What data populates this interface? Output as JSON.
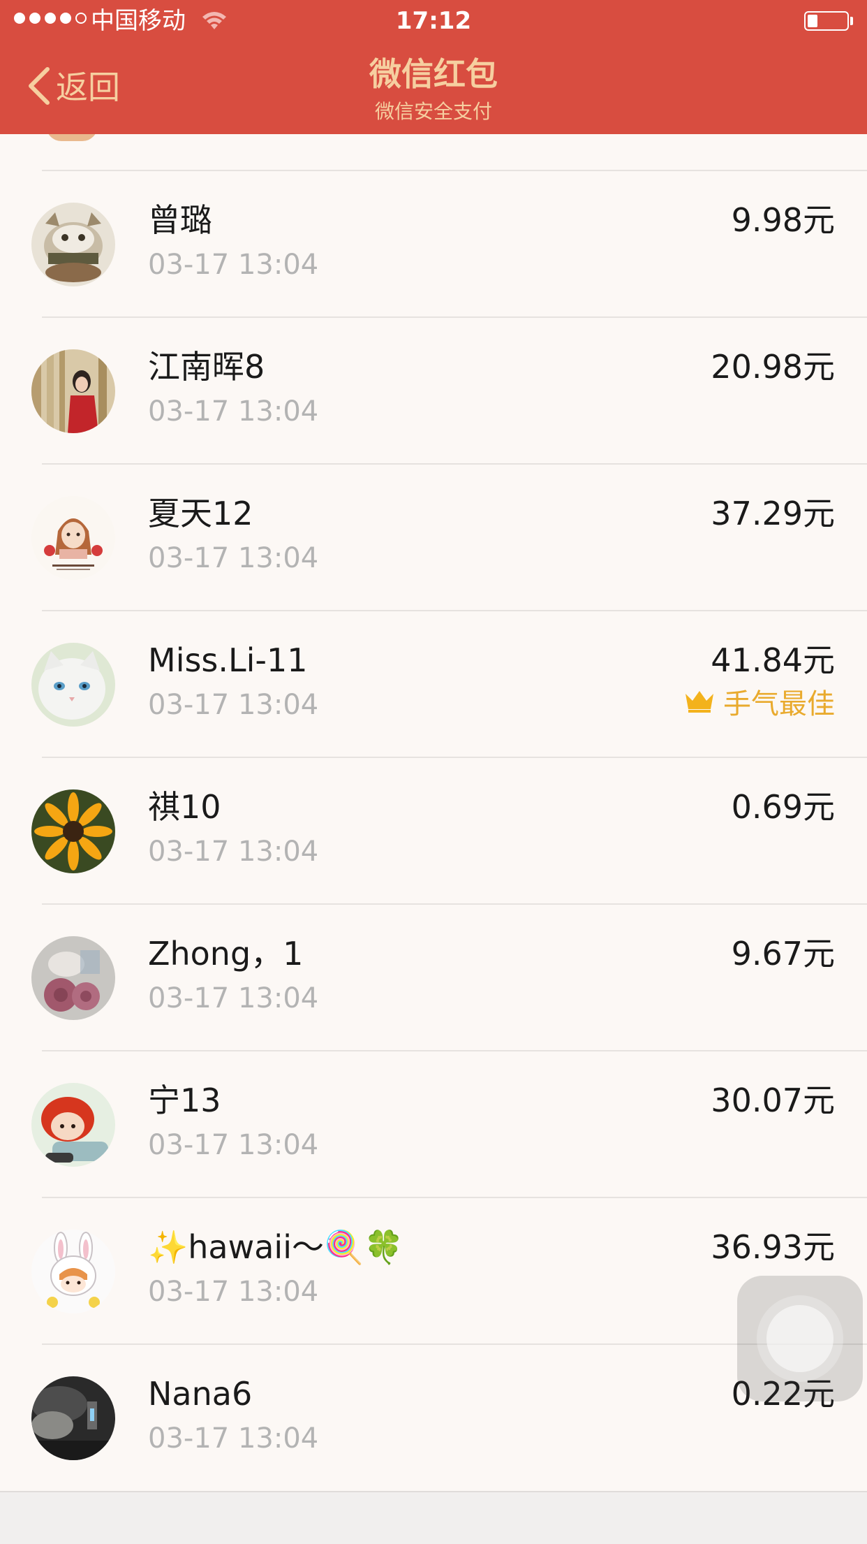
{
  "status_bar": {
    "carrier": "中国移动",
    "time": "17:12",
    "battery_level": 0.25
  },
  "nav": {
    "back_label": "返回",
    "title": "微信红包",
    "subtitle": "微信安全支付"
  },
  "records": [
    {
      "name": "曾璐",
      "time": "03-17 13:04",
      "amount": "9.98元",
      "avatar": "cat-photo-avatar"
    },
    {
      "name": "江南晖8",
      "time": "03-17 13:04",
      "amount": "20.98元",
      "avatar": "person-photo-avatar"
    },
    {
      "name": "夏天12",
      "time": "03-17 13:04",
      "amount": "37.29元",
      "avatar": "girl-illustration-avatar"
    },
    {
      "name": "Miss.Li-11",
      "time": "03-17 13:04",
      "amount": "41.84元",
      "best_label": "手气最佳",
      "avatar": "white-cat-avatar"
    },
    {
      "name": "祺10",
      "time": "03-17 13:04",
      "amount": "0.69元",
      "avatar": "sunflower-avatar"
    },
    {
      "name": "Zhong，1",
      "time": "03-17 13:04",
      "amount": "9.67元",
      "avatar": "flower-photo-avatar"
    },
    {
      "name": "宁13",
      "time": "03-17 13:04",
      "amount": "30.07元",
      "avatar": "red-hair-doll-avatar"
    },
    {
      "name": "✨hawaii～🍭🍀",
      "time": "03-17 13:04",
      "amount": "36.93元",
      "avatar": "bunny-cartoon-avatar"
    },
    {
      "name": "Nana6",
      "time": "03-17 13:04",
      "amount": "0.22元",
      "avatar": "dark-landscape-avatar"
    }
  ],
  "colors": {
    "header_bg": "#d84d40",
    "header_text": "#f6cfa0",
    "best_label": "#e9aa2d",
    "secondary_text": "#b3b3b3"
  }
}
